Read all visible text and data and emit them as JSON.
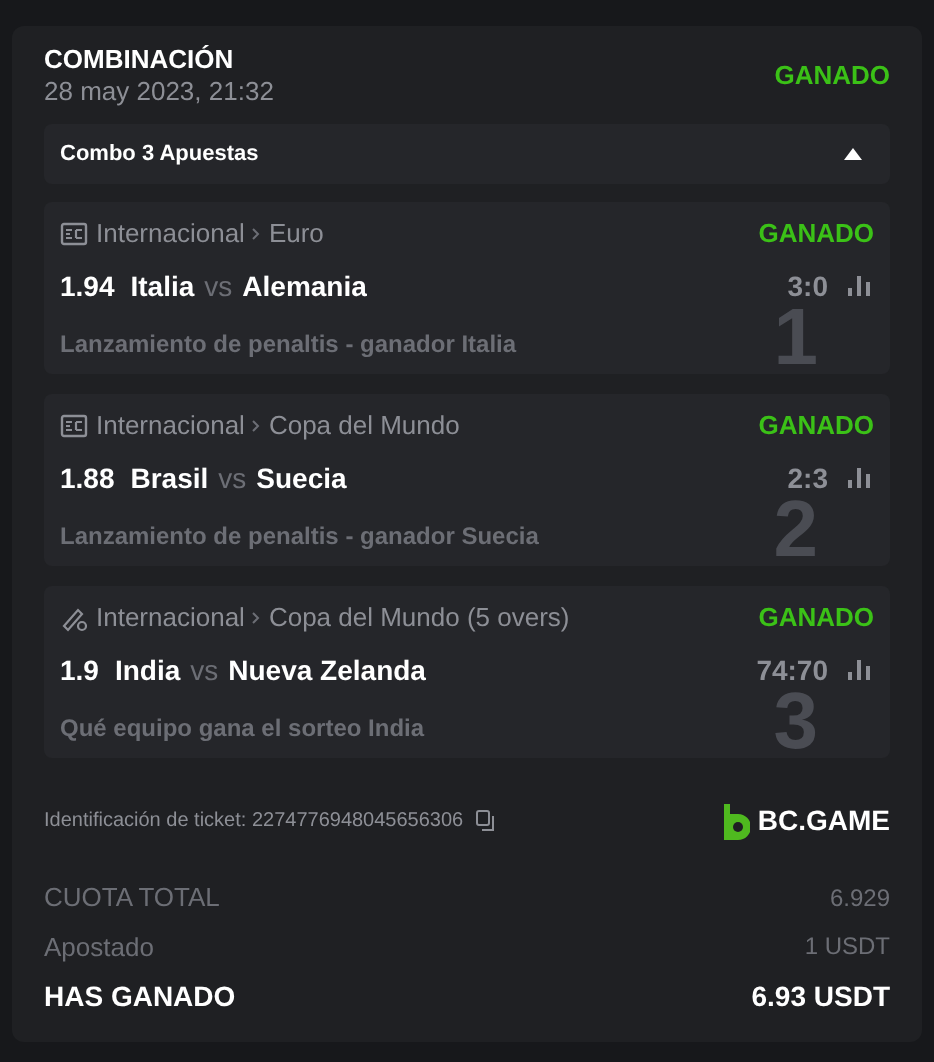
{
  "header": {
    "title": "COMBINACIÓN",
    "date": "28 may 2023, 21:32",
    "status": "GANADO"
  },
  "combo": {
    "label": "Combo 3 Apuestas",
    "expanded": true
  },
  "legs": [
    {
      "kind": "football",
      "category": "Internacional",
      "league": "Euro",
      "status": "GANADO",
      "odds": "1.94",
      "home": "Italia",
      "vs": "vs",
      "away": "Alemania",
      "score": "3:0",
      "market": "Lanzamiento de penaltis - ganador Italia",
      "number": "1"
    },
    {
      "kind": "football",
      "category": "Internacional",
      "league": "Copa del Mundo",
      "status": "GANADO",
      "odds": "1.88",
      "home": "Brasil",
      "vs": "vs",
      "away": "Suecia",
      "score": "2:3",
      "market": "Lanzamiento de penaltis - ganador Suecia",
      "number": "2"
    },
    {
      "kind": "cricket",
      "category": "Internacional",
      "league": "Copa del Mundo (5 overs)",
      "status": "GANADO",
      "odds": "1.9",
      "home": "India",
      "vs": "vs",
      "away": "Nueva Zelanda",
      "score": "74:70",
      "market": "Qué equipo gana el sorteo India",
      "number": "3"
    }
  ],
  "ticket": {
    "label": "Identificación de ticket: 2274776948045656306",
    "brand": "BC.GAME"
  },
  "totals": [
    {
      "label": "CUOTA TOTAL",
      "value": "6.929",
      "kind": "plain"
    },
    {
      "label": "Apostado",
      "value": "1 USDT",
      "kind": "plain"
    },
    {
      "label": "HAS GANADO",
      "value": "6.93 USDT",
      "kind": "strong"
    }
  ]
}
